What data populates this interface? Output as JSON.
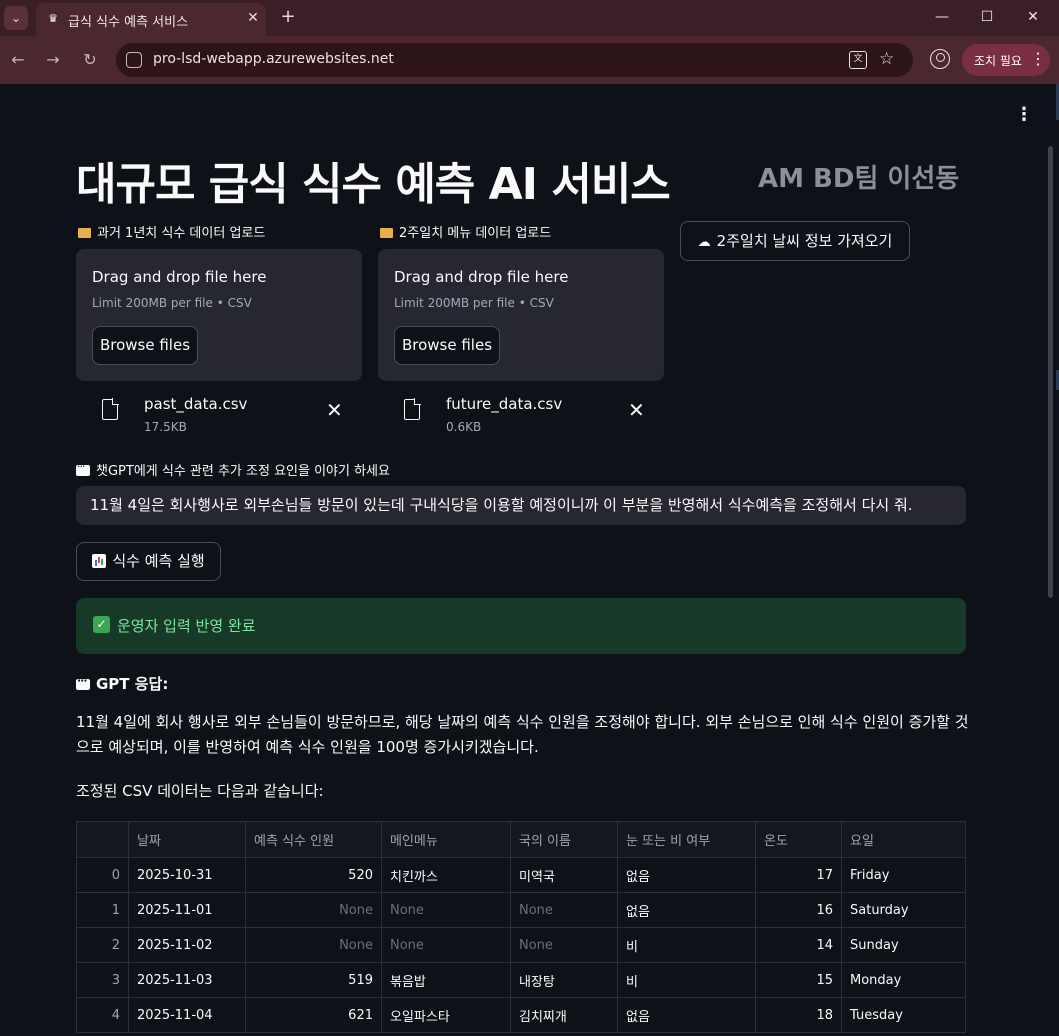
{
  "browser": {
    "tab_title": "급식 식수 예측 서비스",
    "url": "pro-lsd-webapp.azurewebsites.net",
    "action_label": "조치 필요"
  },
  "header": {
    "title": "대규모 급식 식수 예측 AI 서비스",
    "team": "AM BD팀 이선동"
  },
  "uploads": [
    {
      "label": "과거 1년치 식수 데이터 업로드",
      "drop_title": "Drag and drop file here",
      "limit": "Limit 200MB per file • CSV",
      "browse_label": "Browse files",
      "file_name": "past_data.csv",
      "file_size": "17.5KB"
    },
    {
      "label": "2주일치 메뉴 데이터 업로드",
      "drop_title": "Drag and drop file here",
      "limit": "Limit 200MB per file • CSV",
      "browse_label": "Browse files",
      "file_name": "future_data.csv",
      "file_size": "0.6KB"
    }
  ],
  "weather_button": "2주일치 날씨 정보 가져오기",
  "prompt": {
    "label": "챗GPT에게 식수 관련 추가 조정 요인을 이야기 하세요",
    "value": "11월 4일은 회사행사로 외부손님들 방문이 있는데 구내식당을 이용할 예정이니까 이 부분을 반영해서 식수예측을 조정해서 다시 줘."
  },
  "run_button": "식수 예측 실행",
  "success_message": "운영자 입력 반영 완료",
  "gpt": {
    "heading": "GPT 응답:",
    "body": "11월 4일에 회사 행사로 외부 손님들이 방문하므로, 해당 날짜의 예측 식수 인원을 조정해야 합니다. 외부 손님으로 인해 식수 인원이 증가할 것으로 예상되며, 이를 반영하여 예측 식수 인원을 100명 증가시키겠습니다.",
    "csv_intro": "조정된 CSV 데이터는 다음과 같습니다:"
  },
  "table": {
    "columns": [
      "",
      "날짜",
      "예측 식수 인원",
      "메인메뉴",
      "국의 이름",
      "눈 또는 비 여부",
      "온도",
      "요일"
    ],
    "rows": [
      [
        "0",
        "2025-10-31",
        "520",
        "치킨까스",
        "미역국",
        "없음",
        "17",
        "Friday"
      ],
      [
        "1",
        "2025-11-01",
        "None",
        "None",
        "None",
        "없음",
        "16",
        "Saturday"
      ],
      [
        "2",
        "2025-11-02",
        "None",
        "None",
        "None",
        "비",
        "14",
        "Sunday"
      ],
      [
        "3",
        "2025-11-03",
        "519",
        "볶음밥",
        "내장탕",
        "비",
        "15",
        "Monday"
      ],
      [
        "4",
        "2025-11-04",
        "621",
        "오일파스타",
        "김치찌개",
        "없음",
        "18",
        "Tuesday"
      ]
    ]
  }
}
